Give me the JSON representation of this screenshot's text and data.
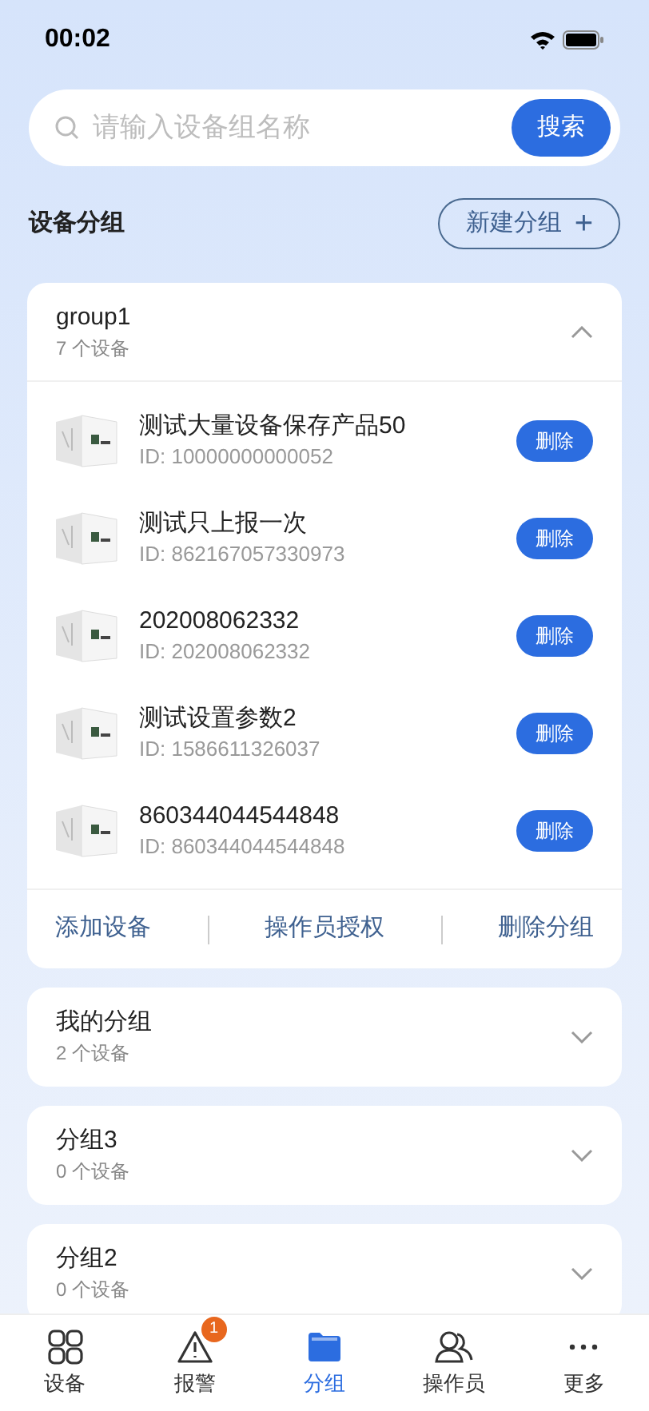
{
  "status_bar": {
    "time": "00:02"
  },
  "search": {
    "placeholder": "请输入设备组名称",
    "button": "搜索"
  },
  "section": {
    "title": "设备分组",
    "new_button": "新建分组",
    "new_icon": "+"
  },
  "groups": [
    {
      "name": "group1",
      "count": "7 个设备",
      "expanded": true,
      "devices": [
        {
          "name": "测试大量设备保存产品50",
          "id": "ID: 10000000000052",
          "action": "删除"
        },
        {
          "name": "测试只上报一次",
          "id": "ID: 862167057330973",
          "action": "删除"
        },
        {
          "name": "202008062332",
          "id": "ID: 202008062332",
          "action": "删除"
        },
        {
          "name": "测试设置参数2",
          "id": "ID: 1586611326037",
          "action": "删除"
        },
        {
          "name": "860344044544848",
          "id": "ID: 860344044544848",
          "action": "删除"
        }
      ],
      "actions": [
        "添加设备",
        "操作员授权",
        "删除分组"
      ]
    },
    {
      "name": "我的分组",
      "count": "2 个设备",
      "expanded": false
    },
    {
      "name": "分组3",
      "count": "0 个设备",
      "expanded": false
    },
    {
      "name": "分组2",
      "count": "0 个设备",
      "expanded": false
    }
  ],
  "tabs": [
    {
      "kind": "grid",
      "label": "设备",
      "selected": false
    },
    {
      "kind": "alert",
      "label": "报警",
      "selected": false,
      "badge": "1"
    },
    {
      "kind": "folder",
      "label": "分组",
      "selected": true
    },
    {
      "kind": "people",
      "label": "操作员",
      "selected": false
    },
    {
      "kind": "more",
      "label": "更多",
      "selected": false
    }
  ]
}
